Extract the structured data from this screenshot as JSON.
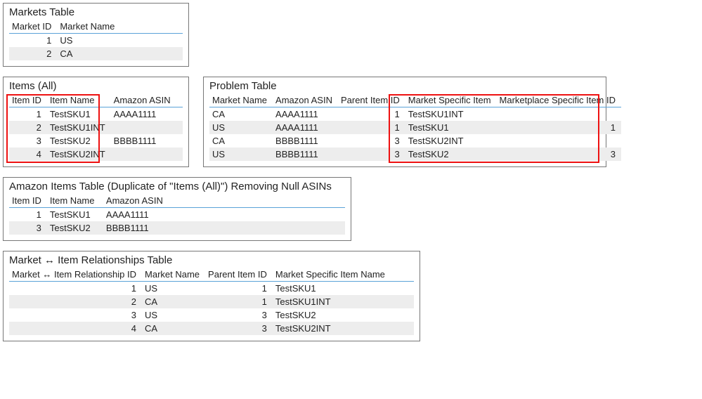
{
  "markets": {
    "title": "Markets Table",
    "headers": [
      "Market ID",
      "Market Name"
    ],
    "rows": [
      {
        "id": "1",
        "name": "US"
      },
      {
        "id": "2",
        "name": "CA"
      }
    ]
  },
  "items": {
    "title": "Items (All)",
    "headers": [
      "Item ID",
      "Item Name",
      "Amazon ASIN"
    ],
    "rows": [
      {
        "id": "1",
        "name": "TestSKU1",
        "asin": "AAAA1111"
      },
      {
        "id": "2",
        "name": "TestSKU1INT",
        "asin": ""
      },
      {
        "id": "3",
        "name": "TestSKU2",
        "asin": "BBBB1111"
      },
      {
        "id": "4",
        "name": "TestSKU2INT",
        "asin": ""
      }
    ]
  },
  "problem": {
    "title": "Problem Table",
    "headers": [
      "Market Name",
      "Amazon ASIN",
      "Parent Item ID",
      "Market Specific Item",
      "Marketplace Specific Item ID"
    ],
    "rows": [
      {
        "market": "CA",
        "asin": "AAAA1111",
        "parent": "1",
        "msi": "TestSKU1INT",
        "msid": ""
      },
      {
        "market": "US",
        "asin": "AAAA1111",
        "parent": "1",
        "msi": "TestSKU1",
        "msid": "1"
      },
      {
        "market": "CA",
        "asin": "BBBB1111",
        "parent": "3",
        "msi": "TestSKU2INT",
        "msid": ""
      },
      {
        "market": "US",
        "asin": "BBBB1111",
        "parent": "3",
        "msi": "TestSKU2",
        "msid": "3"
      }
    ]
  },
  "amazon": {
    "title": "Amazon Items Table (Duplicate of \"Items (All)\") Removing Null ASINs",
    "headers": [
      "Item ID",
      "Item Name",
      "Amazon ASIN"
    ],
    "rows": [
      {
        "id": "1",
        "name": "TestSKU1",
        "asin": "AAAA1111"
      },
      {
        "id": "3",
        "name": "TestSKU2",
        "asin": "BBBB1111"
      }
    ]
  },
  "rel": {
    "title": "Market ↔ Item Relationships Table",
    "headers": [
      "Market ↔ Item Relationship ID",
      "Market Name",
      "Parent Item ID",
      "Market Specific Item Name"
    ],
    "rows": [
      {
        "id": "1",
        "market": "US",
        "parent": "1",
        "name": "TestSKU1"
      },
      {
        "id": "2",
        "market": "CA",
        "parent": "1",
        "name": "TestSKU1INT"
      },
      {
        "id": "3",
        "market": "US",
        "parent": "3",
        "name": "TestSKU2"
      },
      {
        "id": "4",
        "market": "CA",
        "parent": "3",
        "name": "TestSKU2INT"
      }
    ]
  }
}
